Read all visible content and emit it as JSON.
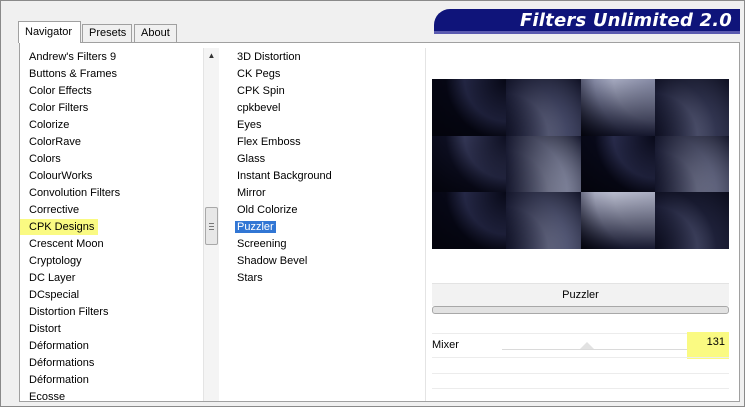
{
  "banner": {
    "title": "Filters Unlimited 2.0"
  },
  "tabs": [
    {
      "label": "Navigator",
      "active": true
    },
    {
      "label": "Presets",
      "active": false
    },
    {
      "label": "About",
      "active": false
    }
  ],
  "categories": [
    "Andrew's Filters 9",
    "Buttons & Frames",
    "Color Effects",
    "Color Filters",
    "Colorize",
    "ColorRave",
    "Colors",
    "ColourWorks",
    "Convolution Filters",
    "Corrective",
    "CPK Designs",
    "Crescent Moon",
    "Cryptology",
    "DC Layer",
    "DCspecial",
    "Distortion Filters",
    "Distort",
    "Déformation",
    "Déformations",
    "Déformation",
    "Ecosse"
  ],
  "selected_category": "CPK Designs",
  "filters": [
    "3D Distortion",
    "CK Pegs",
    "CPK Spin",
    "cpkbevel",
    "Eyes",
    "Flex Emboss",
    "Glass",
    "Instant Background",
    "Mirror",
    "Old Colorize",
    "Puzzler",
    "Screening",
    "Shadow Bevel",
    "Stars"
  ],
  "selected_filter": "Puzzler",
  "current_filter": {
    "name": "Puzzler"
  },
  "mixer": {
    "label": "Mixer",
    "value": "131"
  },
  "colors": {
    "banner": "#0f147a",
    "highlight": "#fafa82",
    "selection": "#3176d4"
  }
}
